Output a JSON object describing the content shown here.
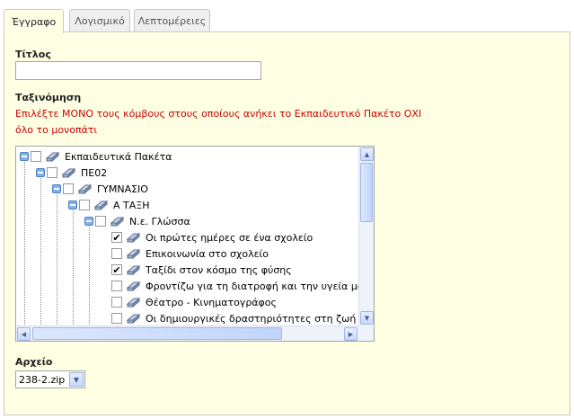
{
  "tabs": [
    {
      "label": "Έγγραφο",
      "active": true
    },
    {
      "label": "Λογισμικό",
      "active": false
    },
    {
      "label": "Λεπτομέρειες",
      "active": false
    }
  ],
  "form": {
    "title_label": "Τίτλος",
    "title_value": "",
    "classification_label": "Ταξινόμηση",
    "note_line1": "Επιλέξτε ΜΟΝΟ τους κόμβους στους οποίους ανήκει το Εκπαιδευτικό Πακέτο ΟΧΙ",
    "note_line2": "όλο το μονοπάτι",
    "file_label": "Αρχείο",
    "file_selected": "238-2.zip"
  },
  "tree": {
    "nodes": [
      {
        "label": "Εκπαιδευτικά Πακέτα",
        "depth": 0,
        "expandable": true,
        "checked": false
      },
      {
        "label": "ΠΕ02",
        "depth": 1,
        "expandable": true,
        "checked": false
      },
      {
        "label": "ΓΥΜΝΑΣΙΟ",
        "depth": 2,
        "expandable": true,
        "checked": false
      },
      {
        "label": "Α ΤΑΞΗ",
        "depth": 3,
        "expandable": true,
        "checked": false
      },
      {
        "label": "Ν.ε. Γλώσσα",
        "depth": 4,
        "expandable": true,
        "checked": false
      },
      {
        "label": "Οι πρώτες ημέρες σε ένα σχολείο",
        "depth": 5,
        "expandable": false,
        "checked": true
      },
      {
        "label": "Επικοινωνία στο σχολείο",
        "depth": 5,
        "expandable": false,
        "checked": false
      },
      {
        "label": "Ταξίδι στον κόσμο της φύσης",
        "depth": 5,
        "expandable": false,
        "checked": true
      },
      {
        "label": "Φροντίζω για τη διατροφή και την υγεία μου",
        "depth": 5,
        "expandable": false,
        "checked": false
      },
      {
        "label": "Θέατρο - Κινηματογράφος",
        "depth": 5,
        "expandable": false,
        "checked": false
      },
      {
        "label": "Οι δημιουργικές δραστηριότητες στη ζωή μου",
        "depth": 5,
        "expandable": false,
        "checked": false
      }
    ]
  },
  "colors": {
    "panel_bg": "#ffffe3",
    "note_red": "#cc0000",
    "scroll_blue": "#9db7e6"
  },
  "icons": {
    "expander": "tree-expander-icon",
    "node": "package-node-icon",
    "scroll_up": "arrow-up-icon",
    "scroll_down": "arrow-down-icon",
    "scroll_left": "arrow-left-icon",
    "scroll_right": "arrow-right-icon",
    "dropdown": "chevron-down-icon"
  }
}
